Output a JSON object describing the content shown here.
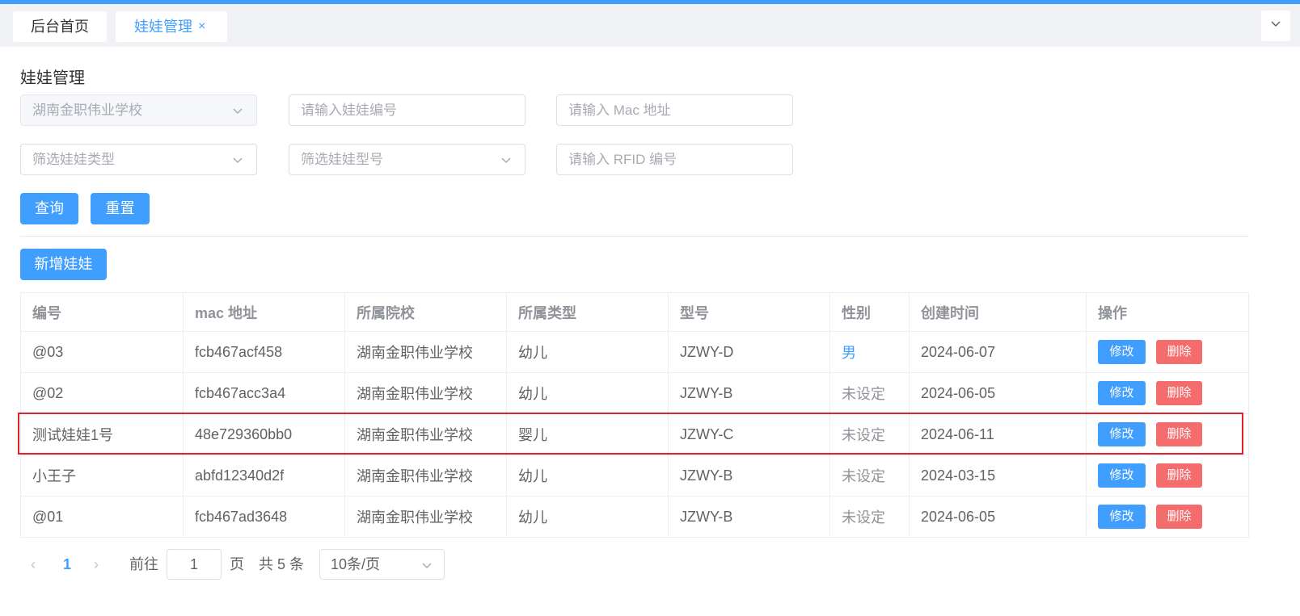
{
  "tabs": [
    {
      "label": "后台首页"
    },
    {
      "label": "娃娃管理",
      "close": "×"
    }
  ],
  "tab_dropdown_icon": "chevron-down-icon",
  "page_title": "娃娃管理",
  "filters": {
    "school": {
      "value": "湖南金职伟业学校"
    },
    "doll_no": {
      "placeholder": "请输入娃娃编号"
    },
    "mac": {
      "placeholder": "请输入 Mac 地址"
    },
    "doll_type": {
      "placeholder": "筛选娃娃类型"
    },
    "doll_model": {
      "placeholder": "筛选娃娃型号"
    },
    "rfid": {
      "placeholder": "请输入 RFID 编号"
    }
  },
  "buttons": {
    "query": "查询",
    "reset": "重置",
    "add": "新增娃娃"
  },
  "table": {
    "headers": [
      "编号",
      "mac 地址",
      "所属院校",
      "所属类型",
      "型号",
      "性别",
      "创建时间",
      "操作"
    ],
    "rows": [
      [
        "@03",
        "fcb467acf458",
        "湖南金职伟业学校",
        "幼儿",
        "JZWY-D",
        "男",
        "2024-06-07"
      ],
      [
        "@02",
        "fcb467acc3a4",
        "湖南金职伟业学校",
        "幼儿",
        "JZWY-B",
        "未设定",
        "2024-06-05"
      ],
      [
        "测试娃娃1号",
        "48e729360bb0",
        "湖南金职伟业学校",
        "婴儿",
        "JZWY-C",
        "未设定",
        "2024-06-11"
      ],
      [
        "小王子",
        "abfd12340d2f",
        "湖南金职伟业学校",
        "幼儿",
        "JZWY-B",
        "未设定",
        "2024-03-15"
      ],
      [
        "@01",
        "fcb467ad3648",
        "湖南金职伟业学校",
        "幼儿",
        "JZWY-B",
        "未设定",
        "2024-06-05"
      ]
    ],
    "edit_label": "修改",
    "delete_label": "删除",
    "highlighted_row": 2
  },
  "pagination": {
    "prev": "‹",
    "current": "1",
    "next": "›",
    "goto_label": "前往",
    "goto_value": "1",
    "page_unit": "页",
    "total": "共 5 条",
    "page_size": "10条/页"
  },
  "colors": {
    "accent": "#409eff",
    "danger": "#f56c6c",
    "highlight": "#e0212b"
  }
}
